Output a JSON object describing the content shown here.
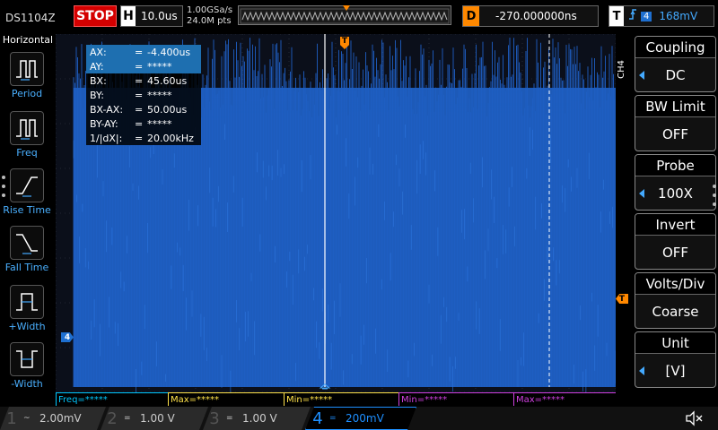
{
  "top": {
    "model": "DS1104Z",
    "run_state": "STOP",
    "timebase_label": "H",
    "timebase_value": "10.0us",
    "sample_rate": "1.00GSa/s",
    "mem_depth": "24.0M pts",
    "delay_label": "D",
    "delay_value": "-270.000000ns",
    "trigger_label": "T",
    "trigger_edge": "rising-edge-icon",
    "trigger_channel": "4",
    "trigger_level": "168mV"
  },
  "left_panel": {
    "title": "Horizontal",
    "items": [
      {
        "label": "Period",
        "icon": "period-icon"
      },
      {
        "label": "Freq",
        "icon": "freq-icon"
      },
      {
        "label": "Rise Time",
        "icon": "rise-time-icon"
      },
      {
        "label": "Fall Time",
        "icon": "fall-time-icon"
      },
      {
        "label": "+Width",
        "icon": "pos-width-icon"
      },
      {
        "label": "-Width",
        "icon": "neg-width-icon"
      }
    ]
  },
  "cursors": [
    {
      "key": "AX:",
      "eq": "=",
      "value": "-4.400us",
      "selected": true
    },
    {
      "key": "AY:",
      "eq": "=",
      "value": "*****",
      "selected": true
    },
    {
      "key": "BX:",
      "eq": "=",
      "value": "45.60us",
      "selected": false
    },
    {
      "key": "BY:",
      "eq": "=",
      "value": "*****",
      "selected": false
    },
    {
      "key": "BX-AX:",
      "eq": "=",
      "value": "50.00us",
      "selected": false
    },
    {
      "key": "BY-AY:",
      "eq": "=",
      "value": "*****",
      "selected": false
    },
    {
      "key": "1/|dX|:",
      "eq": "=",
      "value": "20.00kHz",
      "selected": false
    }
  ],
  "markers": {
    "channel": "4",
    "trigger": "T"
  },
  "measurements": [
    {
      "text": "Freq=*****",
      "color": "#00c8ff"
    },
    {
      "text": "Max=*****",
      "color": "#ffe24a"
    },
    {
      "text": "Min=*****",
      "color": "#ffe24a"
    },
    {
      "text": "Min=*****",
      "color": "#d040e0"
    },
    {
      "text": "Max=*****",
      "color": "#d040e0"
    }
  ],
  "right_panel": {
    "channel_tag": "CH4",
    "buttons": [
      {
        "title": "Coupling",
        "value": "DC",
        "arrow": true
      },
      {
        "title": "BW Limit",
        "value": "OFF",
        "arrow": false
      },
      {
        "title": "Probe",
        "value": "100X",
        "arrow": true
      },
      {
        "title": "Invert",
        "value": "OFF",
        "arrow": false
      },
      {
        "title": "Volts/Div",
        "value": "Coarse",
        "arrow": false
      },
      {
        "title": "Unit",
        "value": "[V]",
        "arrow": true
      }
    ]
  },
  "channels": [
    {
      "num": "1",
      "coupling": "~",
      "scale": "2.00mV",
      "color": "#e8e83a"
    },
    {
      "num": "2",
      "coupling": "=",
      "scale": "1.00 V",
      "color": "#35d0e8"
    },
    {
      "num": "3",
      "coupling": "=",
      "scale": "1.00 V",
      "color": "#d040e0"
    },
    {
      "num": "4",
      "coupling": "=",
      "scale": "200mV",
      "color": "#1e8fff"
    }
  ],
  "colors": {
    "ch4": "#1e8fff",
    "trigger": "#ff8800",
    "waveform": "#1d5ab8"
  }
}
